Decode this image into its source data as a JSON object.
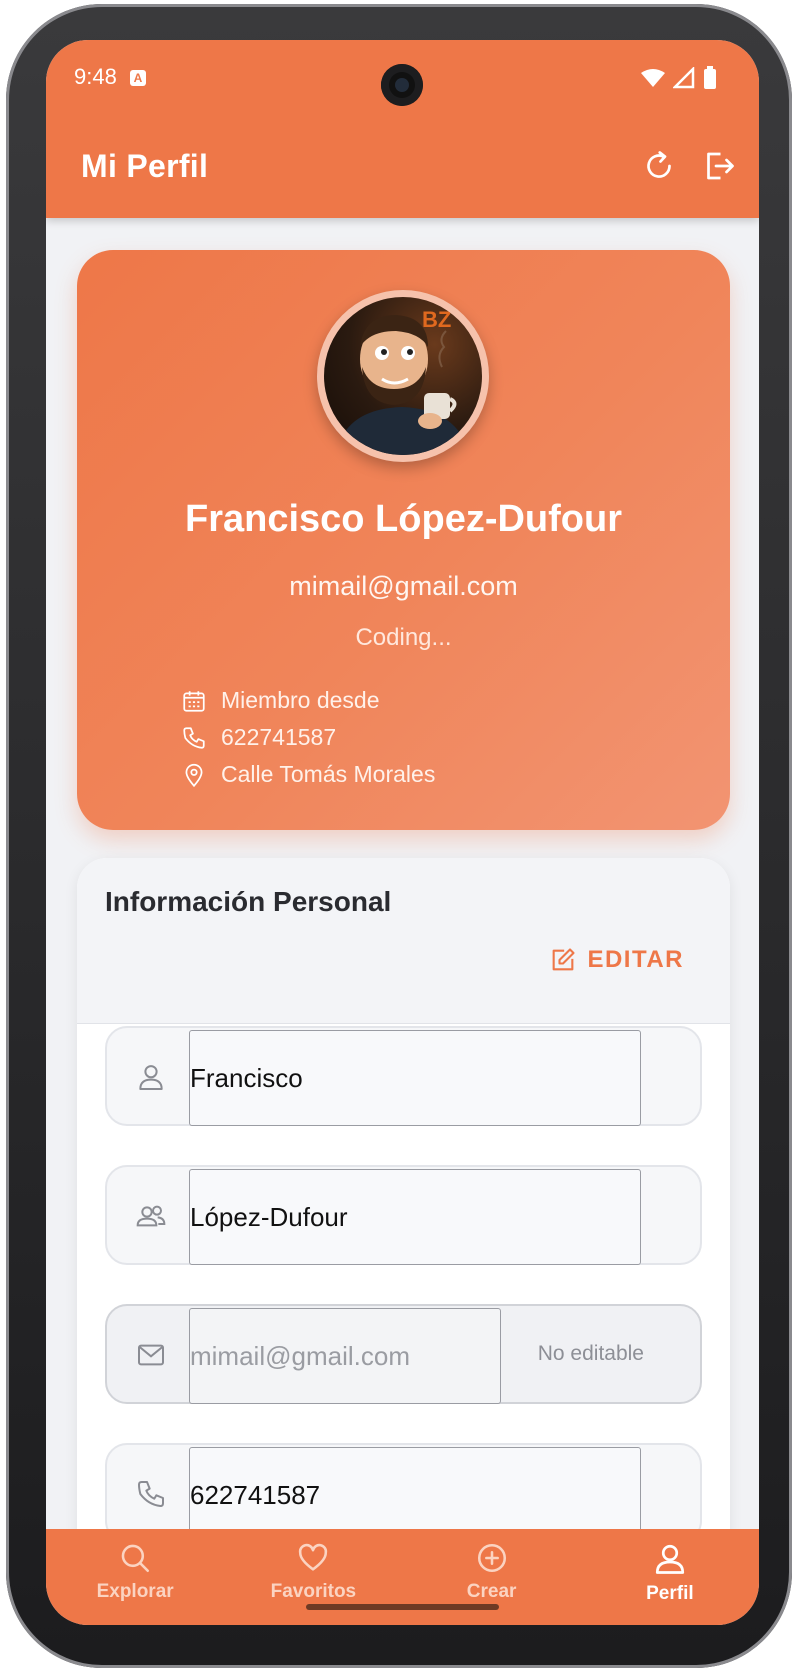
{
  "status_bar": {
    "time": "9:48",
    "notif_badge": "A"
  },
  "app_bar": {
    "title": "Mi Perfil",
    "actions": [
      "refresh-icon",
      "logout-icon"
    ]
  },
  "profile": {
    "name": "Francisco López-Dufour",
    "email": "mimail@gmail.com",
    "status": "Coding...",
    "avatar_brand": "BZ",
    "meta": [
      {
        "icon": "calendar-icon",
        "text": "Miembro desde"
      },
      {
        "icon": "phone-icon",
        "text": "622741587"
      },
      {
        "icon": "location-pin-icon",
        "text": "Calle Tomás Morales"
      }
    ]
  },
  "personal_info": {
    "title": "Información Personal",
    "edit_label": "EDITAR",
    "fields": [
      {
        "icon": "person-icon",
        "value": "Francisco"
      },
      {
        "icon": "people-icon",
        "value": "López-Dufour"
      },
      {
        "icon": "mail-icon",
        "value": "mimail@gmail.com",
        "note": "No editable"
      },
      {
        "icon": "phone-icon",
        "value": "622741587"
      }
    ]
  },
  "bottom_nav": {
    "items": [
      {
        "label": "Explorar",
        "icon": "search-icon"
      },
      {
        "label": "Favoritos",
        "icon": "heart-icon"
      },
      {
        "label": "Crear",
        "icon": "plus-circle-icon"
      },
      {
        "label": "Perfil",
        "icon": "person-icon"
      }
    ],
    "active": "Perfil"
  },
  "colors": {
    "accent": "#ee7748",
    "background": "#f1f2f5",
    "card": "#ffffff"
  }
}
